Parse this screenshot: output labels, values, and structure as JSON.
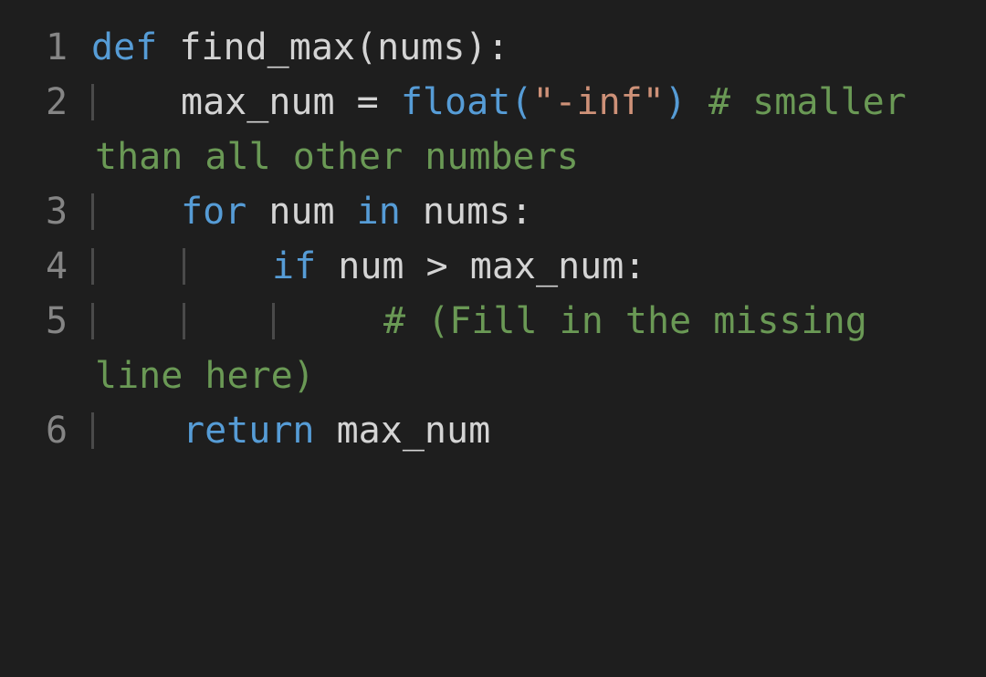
{
  "editor": {
    "lines": [
      {
        "number": "1",
        "tokens": [
          {
            "text": "def",
            "kind": "keyword"
          },
          {
            "text": " find_max(nums):",
            "kind": "text"
          }
        ]
      },
      {
        "number": "2",
        "tokens": [
          {
            "text": "max_num = ",
            "kind": "text"
          },
          {
            "text": "float(",
            "kind": "builtin"
          },
          {
            "text": "\"-inf\"",
            "kind": "string"
          },
          {
            "text": ")",
            "kind": "builtin"
          },
          {
            "text": " # smaller",
            "kind": "comment"
          }
        ],
        "wrap": "than all other numbers"
      },
      {
        "number": "3",
        "tokens": [
          {
            "text": "for",
            "kind": "keyword"
          },
          {
            "text": " num ",
            "kind": "text"
          },
          {
            "text": "in",
            "kind": "keyword"
          },
          {
            "text": " nums:",
            "kind": "text"
          }
        ]
      },
      {
        "number": "4",
        "tokens": [
          {
            "text": "if",
            "kind": "keyword"
          },
          {
            "text": " num > max_num:",
            "kind": "text"
          }
        ]
      },
      {
        "number": "5",
        "tokens": [
          {
            "text": "# (Fill in the missing",
            "kind": "comment"
          }
        ],
        "wrap": "line here)"
      },
      {
        "number": "6",
        "tokens": [
          {
            "text": "return",
            "kind": "keyword"
          },
          {
            "text": " max_num",
            "kind": "text"
          }
        ]
      }
    ]
  },
  "colors": {
    "background": "#1e1e1e",
    "line_number": "#858585",
    "keyword": "#569cd6",
    "string": "#ce9178",
    "comment": "#6a9955",
    "text": "#d4d4d4"
  }
}
